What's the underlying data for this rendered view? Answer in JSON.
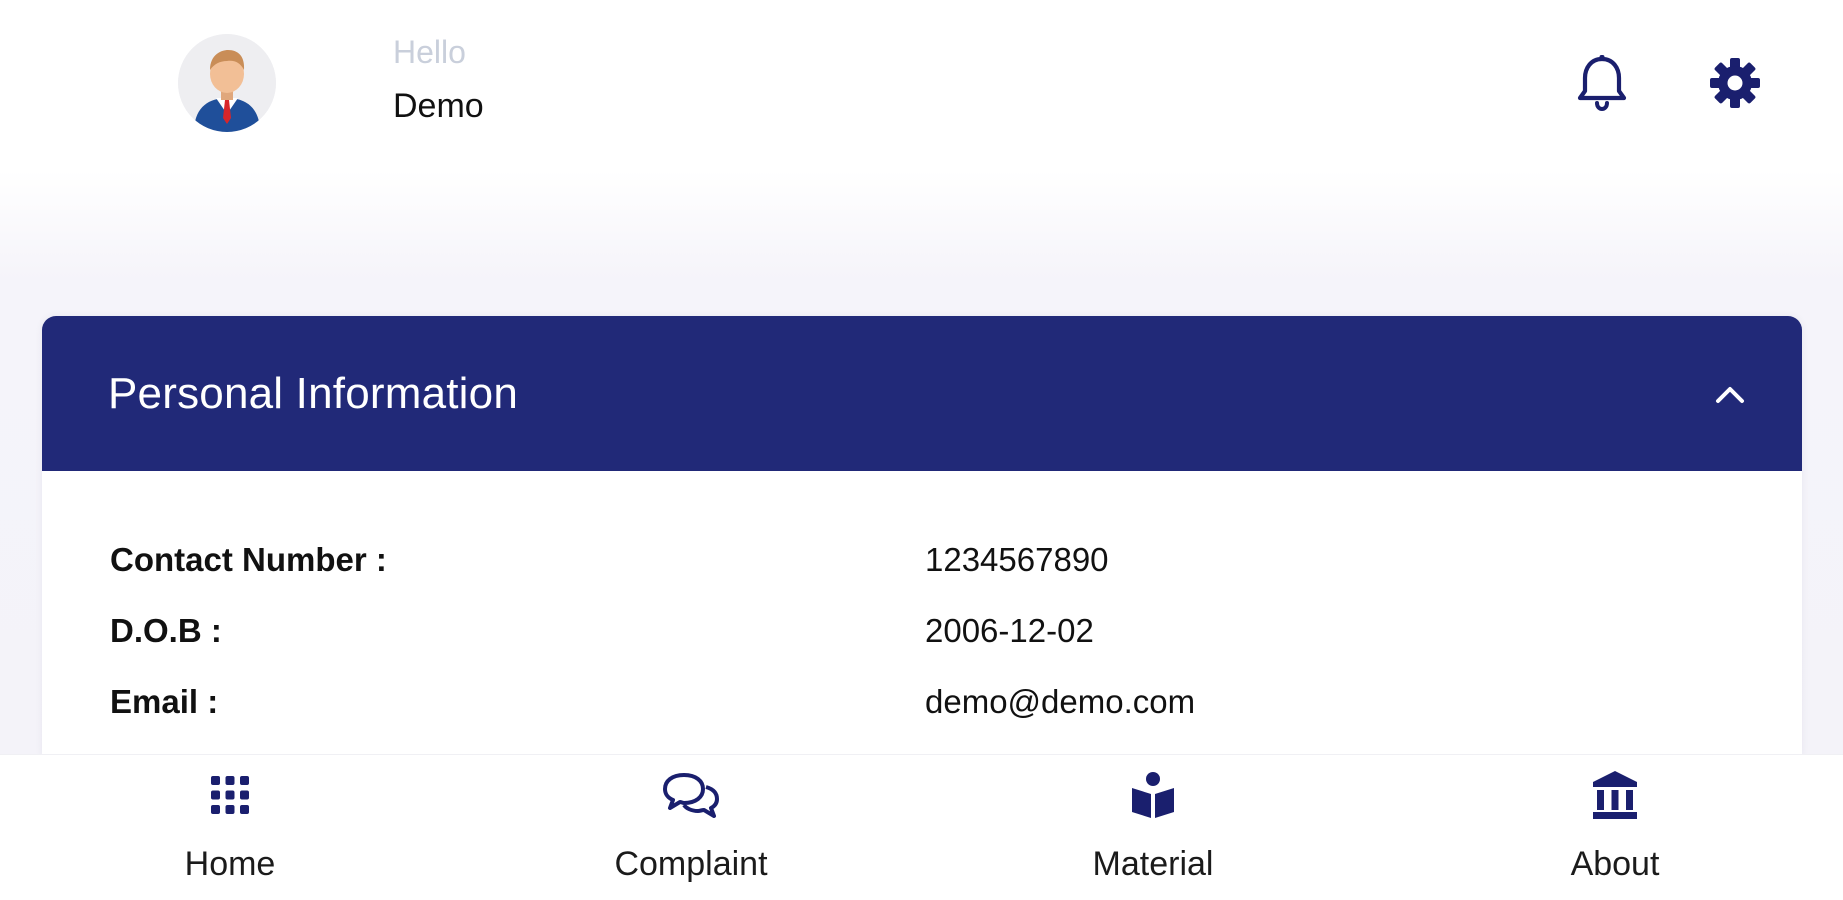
{
  "header": {
    "greeting": "Hello",
    "user_name": "Demo",
    "avatar_icon": "user-avatar-icon",
    "notification_icon": "bell-icon",
    "settings_icon": "gear-icon"
  },
  "card": {
    "title": "Personal Information",
    "toggle_icon": "chevron-up-icon",
    "rows": [
      {
        "label": "Contact Number :",
        "value": "1234567890"
      },
      {
        "label": "D.O.B :",
        "value": "2006-12-02"
      },
      {
        "label": "Email :",
        "value": "demo@demo.com"
      }
    ]
  },
  "nav": {
    "items": [
      {
        "label": "Home",
        "icon": "grid-icon"
      },
      {
        "label": "Complaint",
        "icon": "chat-bubbles-icon"
      },
      {
        "label": "Material",
        "icon": "book-reader-icon"
      },
      {
        "label": "About",
        "icon": "institution-icon"
      }
    ]
  },
  "colors": {
    "primary": "#212978",
    "icon": "#1a1f6e",
    "background": "#f4f3f9",
    "greeting": "#c9cfdb"
  }
}
